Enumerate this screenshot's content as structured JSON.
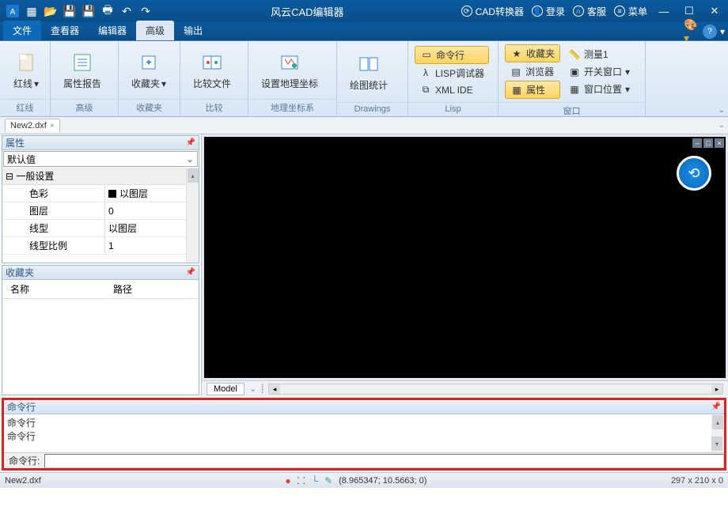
{
  "title": "风云CAD编辑器",
  "titlebar_right": {
    "converter": "CAD转换器",
    "login": "登录",
    "service": "客服",
    "menu": "菜单"
  },
  "menu": {
    "file": "文件",
    "viewer": "查看器",
    "editor": "编辑器",
    "advanced": "高级",
    "output": "输出"
  },
  "ribbon": {
    "redline_btn": "红线",
    "redline_group": "红线",
    "prop_report": "属性报告",
    "advanced_group": "高级",
    "favorites_btn": "收藏夹",
    "favorites_group": "收藏夹",
    "compare_file": "比较文件",
    "compare_group": "比较",
    "geo_coord": "设置地理坐标",
    "geo_group": "地理坐标系",
    "draw_stats": "绘图统计",
    "drawings_group": "Drawings",
    "cmd_line": "命令行",
    "lisp_debugger": "LISP调试器",
    "xml_ide": "XML IDE",
    "lisp_group": "Lisp",
    "fav_small": "收藏夹",
    "browser": "浏览器",
    "properties": "属性",
    "measure1": "测量1",
    "open_window": "开关窗口",
    "window_pos": "窗口位置",
    "window_group": "窗口"
  },
  "doc_tab": "New2.dxf",
  "props_panel": {
    "title": "属性",
    "default_val": "默认值",
    "general_section": "一般设置",
    "rows": {
      "color_k": "色彩",
      "color_v": "以图层",
      "layer_k": "图层",
      "layer_v": "0",
      "linetype_k": "线型",
      "linetype_v": "以图层",
      "scale_k": "线型比例",
      "scale_v": "1"
    }
  },
  "fav_panel": {
    "title": "收藏夹",
    "col_name": "名称",
    "col_path": "路径"
  },
  "model_tab": "Model",
  "cmd": {
    "title": "命令行",
    "line1": "命令行",
    "line2": "命令行",
    "label": "命令行:"
  },
  "status": {
    "file": "New2.dxf",
    "coords": "(8.965347; 10.5663; 0)",
    "dims": "297 x 210 x 0"
  }
}
